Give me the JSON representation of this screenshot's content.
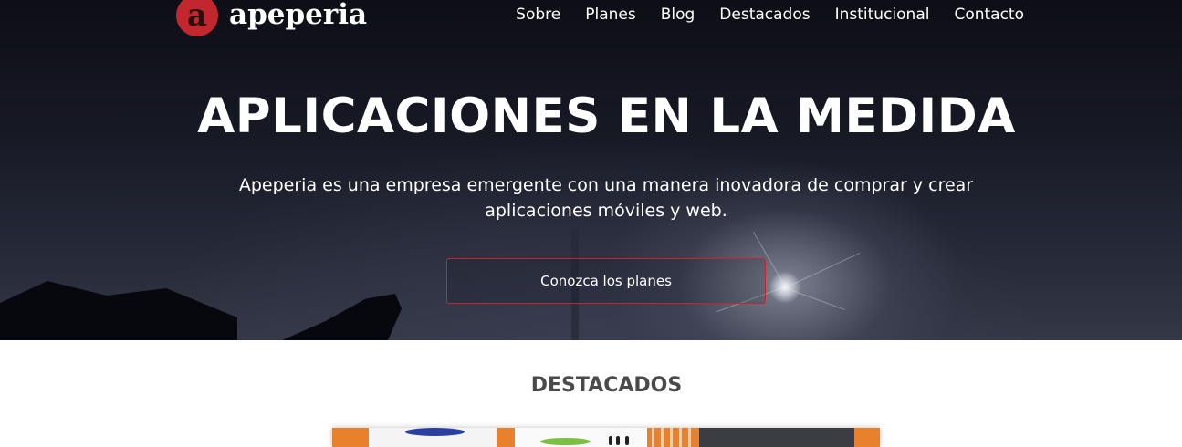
{
  "header": {
    "brand": {
      "logo_letter": "a",
      "name": "apeperia"
    },
    "nav": [
      "Sobre",
      "Planes",
      "Blog",
      "Destacados",
      "Institucional",
      "Contacto"
    ]
  },
  "hero": {
    "title": "APLICACIONES EN LA MEDIDA",
    "lead": "Apeperia es una empresa emergente con una manera inovadora de comprar y crear aplicaciones móviles y web.",
    "button_label": "Conozca los planes"
  },
  "featured": {
    "title": "DESTACADOS"
  },
  "colors": {
    "accent": "#c1272d",
    "hero_dark": "#171925",
    "section_title": "#4a4a4a",
    "featured_orange": "#e9802b"
  }
}
